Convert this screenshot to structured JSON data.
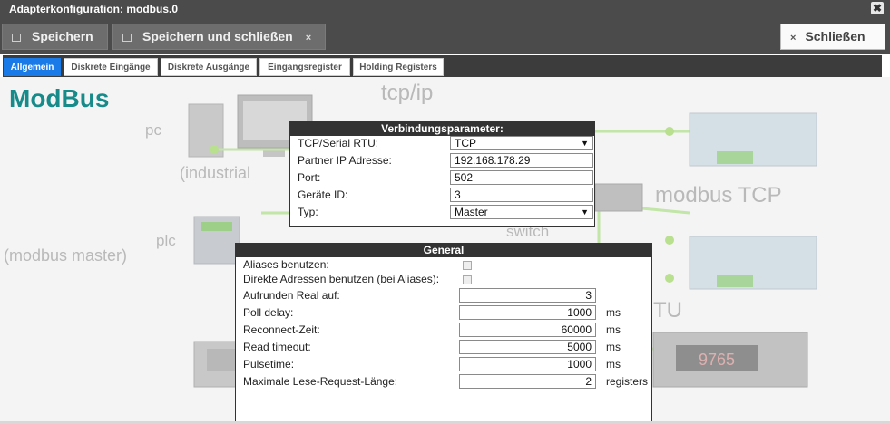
{
  "window": {
    "title": "Adapterkonfiguration: modbus.0",
    "close_glyph": "✖"
  },
  "toolbar": {
    "save_label": "Speichern",
    "save_close_label": "Speichern und schließen",
    "save_close_x": "×",
    "close_label": "Schließen",
    "close_x": "×"
  },
  "tabs": [
    {
      "label": "Allgemein",
      "active": true
    },
    {
      "label": "Diskrete Eingänge",
      "active": false
    },
    {
      "label": "Diskrete Ausgänge",
      "active": false
    },
    {
      "label": "Eingangsregister",
      "active": false
    },
    {
      "label": "Holding Registers",
      "active": false
    }
  ],
  "page": {
    "heading": "ModBus"
  },
  "background_labels": {
    "tcpip": "tcp/ip",
    "pc": "pc",
    "industrial": "(industrial",
    "modbus_tcp": "modbus TCP",
    "switch": "switch",
    "plc": "plc",
    "modbus_master": "(modbus master)",
    "rtu": "TU",
    "display": "9765"
  },
  "connection": {
    "title": "Verbindungsparameter:",
    "rows": [
      {
        "label": "TCP/Serial RTU:",
        "value": "TCP",
        "type": "select",
        "caret": "▼"
      },
      {
        "label": "Partner IP Adresse:",
        "value": "192.168.178.29",
        "type": "text"
      },
      {
        "label": "Port:",
        "value": "502",
        "type": "text"
      },
      {
        "label": "Geräte ID:",
        "value": "3",
        "type": "text"
      },
      {
        "label": "Typ:",
        "value": "Master",
        "type": "select",
        "caret": "▼"
      }
    ]
  },
  "general": {
    "title": "General",
    "aliases_label": "Aliases benutzen:",
    "direct_label": "Direkte Adressen benutzen (bei Aliases):",
    "rows": [
      {
        "label": "Aufrunden Real auf:",
        "value": "3",
        "unit": ""
      },
      {
        "label": "Poll delay:",
        "value": "1000",
        "unit": "ms"
      },
      {
        "label": "Reconnect-Zeit:",
        "value": "60000",
        "unit": "ms"
      },
      {
        "label": "Read timeout:",
        "value": "5000",
        "unit": "ms"
      },
      {
        "label": "Pulsetime:",
        "value": "1000",
        "unit": "ms"
      },
      {
        "label": "Maximale Lese-Request-Länge:",
        "value": "2",
        "unit": "registers"
      }
    ]
  }
}
